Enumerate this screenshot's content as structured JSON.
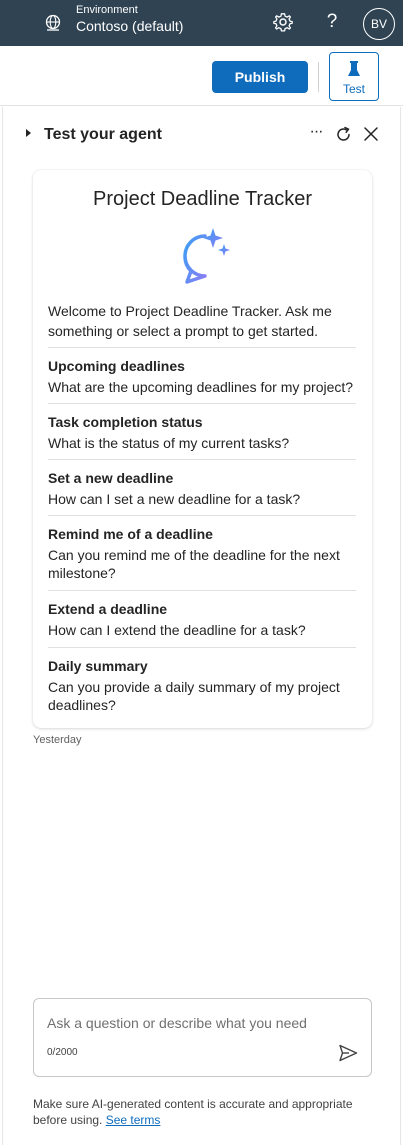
{
  "header": {
    "environment_label": "Environment",
    "environment_name": "Contoso (default)",
    "help_glyph": "?",
    "avatar_initials": "BV"
  },
  "toolbar": {
    "publish_label": "Publish",
    "test_label": "Test"
  },
  "panel": {
    "title": "Test your agent",
    "more_glyph": "···"
  },
  "card": {
    "title": "Project Deadline Tracker",
    "welcome": "Welcome to Project Deadline Tracker. Ask me something or select a prompt to get started.",
    "prompts": [
      {
        "title": "Upcoming deadlines",
        "text": "What are the upcoming deadlines for my project?"
      },
      {
        "title": "Task completion status",
        "text": "What is the status of my current tasks?"
      },
      {
        "title": "Set a new deadline",
        "text": "How can I set a new deadline for a task?"
      },
      {
        "title": "Remind me of a deadline",
        "text": "Can you remind me of the deadline for the next milestone?"
      },
      {
        "title": "Extend a deadline",
        "text": "How can I extend the deadline for a task?"
      },
      {
        "title": "Daily summary",
        "text": "Can you provide a daily summary of my project deadlines?"
      }
    ]
  },
  "timestamp": "Yesterday",
  "input": {
    "placeholder": "Ask a question or describe what you need",
    "counter": "0/2000"
  },
  "disclaimer": {
    "text": "Make sure AI-generated content is accurate and appropriate before using. ",
    "link": "See terms"
  },
  "icons": {
    "environment": "globe-environment-icon",
    "settings": "gear-icon",
    "help": "help-icon",
    "test": "beaker-icon",
    "collapse": "caret-right-icon",
    "more": "more-icon",
    "refresh": "refresh-icon",
    "close": "close-icon",
    "chat": "chat-sparkle-icon",
    "send": "send-icon"
  },
  "colors": {
    "header_bg": "#2f4353",
    "accent": "#0f6cbd",
    "chat_icon_gradient": [
      "#3aa0f3",
      "#8b7cf6"
    ]
  }
}
